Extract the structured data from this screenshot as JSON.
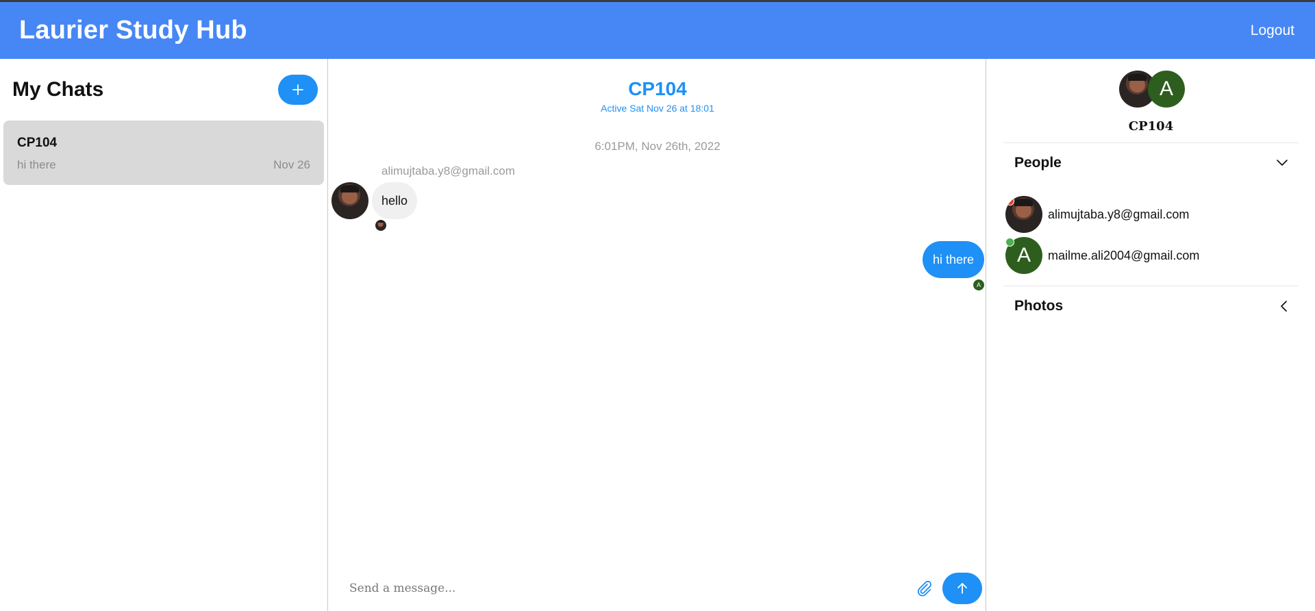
{
  "header": {
    "brand": "Laurier Study Hub",
    "logout_label": "Logout"
  },
  "sidebar": {
    "title": "My Chats",
    "add_icon": "plus-icon",
    "chats": [
      {
        "title": "CP104",
        "last_message": "hi there",
        "date": "Nov 26"
      }
    ]
  },
  "chat": {
    "title": "CP104",
    "active_status": "Active Sat Nov 26 at 18:01",
    "timestamp": "6:01PM, Nov 26th, 2022",
    "messages": [
      {
        "sender": "alimujtaba.y8@gmail.com",
        "text": "hello",
        "direction": "incoming"
      },
      {
        "sender": "",
        "text": "hi there",
        "direction": "outgoing",
        "read_avatar_letter": "A"
      }
    ],
    "composer": {
      "placeholder": "Send a message...",
      "attach_icon": "paperclip-icon",
      "send_icon": "arrow-up-icon"
    }
  },
  "details": {
    "title": "CP104",
    "group_avatar_letter": "A",
    "people_label": "People",
    "people_icon": "chevron-down-icon",
    "people": [
      {
        "email": "alimujtaba.y8@gmail.com",
        "status_color": "#e53935"
      },
      {
        "email": "mailme.ali2004@gmail.com",
        "status_color": "#4caf50",
        "avatar_letter": "A"
      }
    ],
    "photos_label": "Photos",
    "photos_icon": "chevron-left-icon"
  },
  "colors": {
    "header": "#4687f5",
    "accent": "#1e90f6",
    "avatar_green": "#2d5e1e"
  }
}
